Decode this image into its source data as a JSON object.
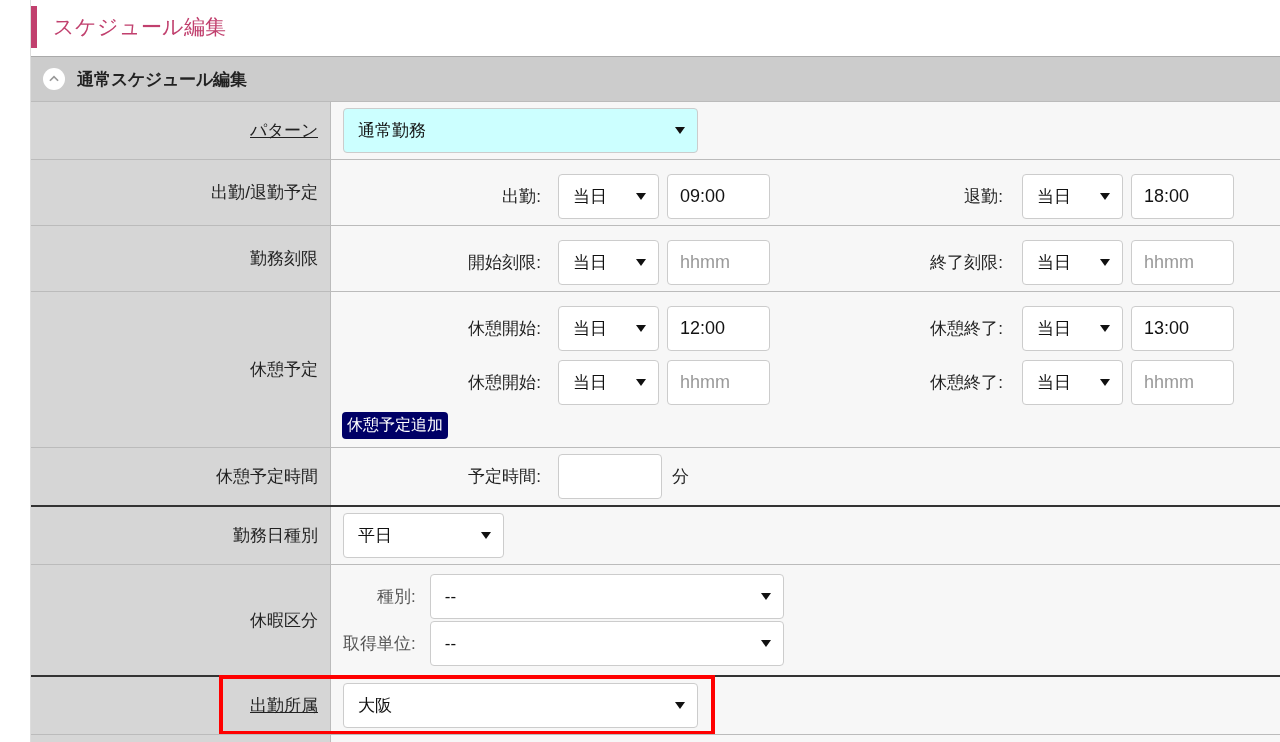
{
  "page": {
    "title": "スケジュール編集"
  },
  "section": {
    "title": "通常スケジュール編集",
    "expanded": true
  },
  "rows": [
    {
      "kind": "select",
      "label": "パターン",
      "link": true,
      "separator_above": false,
      "highlighted": false,
      "select": {
        "value": "通常勤務",
        "tinted": true
      }
    },
    {
      "kind": "times",
      "label": "出勤/退勤予定",
      "link": false,
      "separator_above": false,
      "highlighted": false,
      "lines": [
        {
          "fields": [
            {
              "label": "出勤:",
              "day": "当日",
              "value": "09:00"
            },
            {
              "label": "退勤:",
              "day": "当日",
              "value": "18:00"
            }
          ]
        }
      ]
    },
    {
      "kind": "times",
      "label": "勤務刻限",
      "link": false,
      "separator_above": false,
      "highlighted": false,
      "lines": [
        {
          "fields": [
            {
              "label": "開始刻限:",
              "day": "当日",
              "placeholder": "hhmm"
            },
            {
              "label": "終了刻限:",
              "day": "当日",
              "placeholder": "hhmm"
            }
          ]
        }
      ]
    },
    {
      "kind": "times",
      "label": "休憩予定",
      "link": false,
      "separator_above": false,
      "highlighted": false,
      "lines": [
        {
          "fields": [
            {
              "label": "休憩開始:",
              "day": "当日",
              "value": "12:00"
            },
            {
              "label": "休憩終了:",
              "day": "当日",
              "value": "13:00"
            }
          ]
        },
        {
          "fields": [
            {
              "label": "休憩開始:",
              "day": "当日",
              "placeholder": "hhmm"
            },
            {
              "label": "休憩終了:",
              "day": "当日",
              "placeholder": "hhmm"
            }
          ]
        }
      ],
      "button": "休憩予定追加"
    },
    {
      "kind": "duration",
      "label": "休憩予定時間",
      "link": false,
      "separator_above": false,
      "highlighted": false,
      "field_label": "予定時間:",
      "unit": "分"
    },
    {
      "kind": "select",
      "label": "勤務日種別",
      "link": false,
      "separator_above": true,
      "highlighted": false,
      "select": {
        "value": "平日",
        "tinted": false
      }
    },
    {
      "kind": "leave",
      "label": "休暇区分",
      "link": false,
      "separator_above": false,
      "highlighted": false,
      "fields": [
        {
          "label": "種別:",
          "value": "--"
        },
        {
          "label": "取得単位:",
          "value": "--"
        }
      ]
    },
    {
      "kind": "select",
      "label": "出勤所属",
      "link": true,
      "separator_above": true,
      "highlighted": true,
      "select": {
        "value": "大阪",
        "tinted": false
      }
    }
  ]
}
